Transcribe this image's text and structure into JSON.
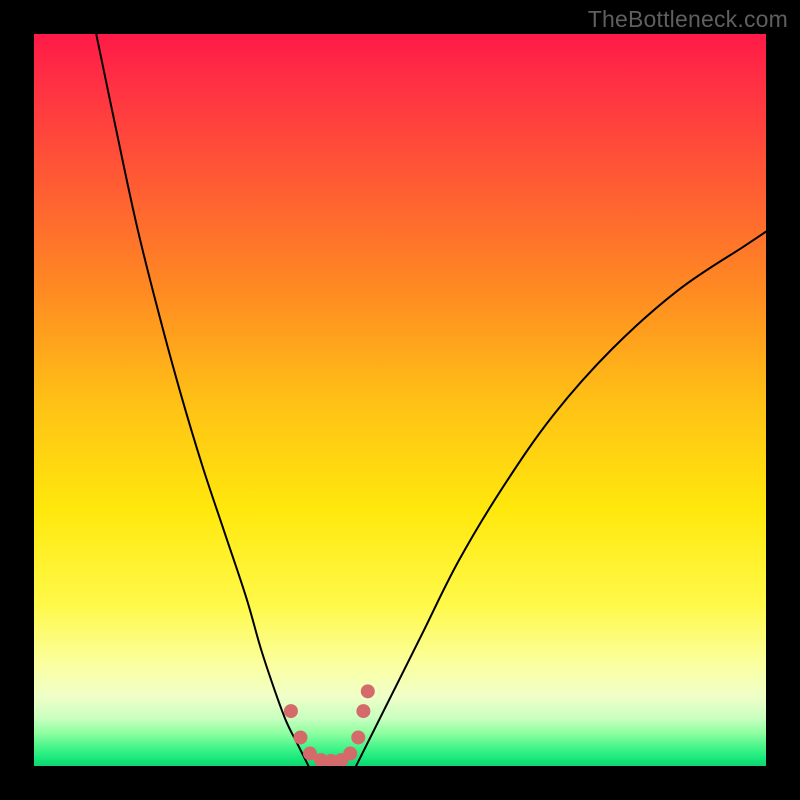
{
  "watermark": "TheBottleneck.com",
  "chart_data": {
    "type": "line",
    "title": "",
    "xlabel": "",
    "ylabel": "",
    "xlim": [
      0,
      100
    ],
    "ylim": [
      0,
      100
    ],
    "background_gradient_stops": [
      {
        "offset": 0.0,
        "color": "#ff1a47"
      },
      {
        "offset": 0.06,
        "color": "#ff2e44"
      },
      {
        "offset": 0.2,
        "color": "#ff5a34"
      },
      {
        "offset": 0.35,
        "color": "#ff8a22"
      },
      {
        "offset": 0.5,
        "color": "#ffc016"
      },
      {
        "offset": 0.65,
        "color": "#ffe80c"
      },
      {
        "offset": 0.78,
        "color": "#fff94a"
      },
      {
        "offset": 0.86,
        "color": "#fbff9e"
      },
      {
        "offset": 0.905,
        "color": "#f0ffc8"
      },
      {
        "offset": 0.935,
        "color": "#c8ffc0"
      },
      {
        "offset": 0.955,
        "color": "#8effa0"
      },
      {
        "offset": 0.975,
        "color": "#44f58a"
      },
      {
        "offset": 0.99,
        "color": "#18e87a"
      },
      {
        "offset": 1.0,
        "color": "#0fd46e"
      }
    ],
    "series": [
      {
        "name": "bottleneck-curve-left",
        "x": [
          8.5,
          11,
          14,
          17,
          20,
          23,
          26,
          29,
          31,
          33,
          34.5,
          36,
          37.5
        ],
        "y": [
          100,
          88,
          74,
          62,
          51,
          41,
          32,
          23,
          16,
          10,
          6,
          3,
          0
        ],
        "color": "#000000",
        "stroke_width": 2
      },
      {
        "name": "bottleneck-curve-right",
        "x": [
          44,
          46,
          49,
          53,
          58,
          64,
          71,
          79,
          88,
          97,
          100
        ],
        "y": [
          0,
          4,
          10,
          18,
          28,
          38,
          48,
          57,
          65,
          71,
          73
        ],
        "color": "#000000",
        "stroke_width": 2
      },
      {
        "name": "highlight-dots",
        "type": "scatter",
        "x": [
          35.1,
          36.4,
          37.7,
          39.2,
          40.6,
          42.0,
          43.2,
          44.3,
          45.0,
          45.6
        ],
        "y": [
          7.5,
          3.9,
          1.7,
          0.8,
          0.7,
          0.8,
          1.7,
          3.9,
          7.5,
          10.2
        ],
        "color": "#d46a6a",
        "marker_size": 14
      }
    ],
    "grid": false,
    "legend": false
  }
}
